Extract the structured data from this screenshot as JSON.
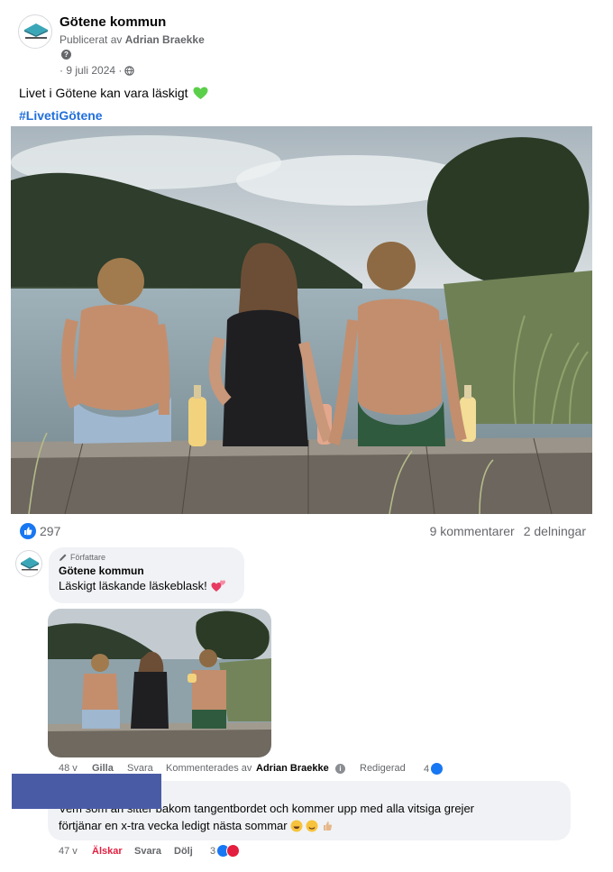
{
  "post": {
    "page_name": "Götene kommun",
    "byline_prefix": "Publicerat av",
    "byline_author": "Adrian Braekke",
    "date": "· 9 juli 2024 ·",
    "text": "Livet i Götene kan vara läskigt",
    "hashtag": "#LivetiGötene",
    "logo_icon": "gotene-kommun-logo",
    "heart_emoji_color": "#5ccf4a"
  },
  "stats": {
    "like_count": "297",
    "comments": "9 kommentarer",
    "shares": "2 delningar",
    "like_color": "#1877f2"
  },
  "comment1": {
    "author_tag": "Författare",
    "name": "Götene kommun",
    "text": "Läskigt läskande läskeblask!",
    "time": "48 v",
    "like": "Gilla",
    "reply": "Svara",
    "commented_by_prefix": "Kommenterades av",
    "commented_by": "Adrian Braekke",
    "edited": "Redigerad",
    "reaction_count": "4"
  },
  "comment2": {
    "line1": "Vem som än sitter bakom tangentbordet och kommer upp med alla vitsiga grejer",
    "line2": "förtjänar en x-tra vecka ledigt nästa sommar",
    "time": "47 v",
    "love": "Älskar",
    "reply": "Svara",
    "hide": "Dölj",
    "reaction_count": "3",
    "love_color": "#e41e3f",
    "redaction_color": "#4a5ba6"
  }
}
